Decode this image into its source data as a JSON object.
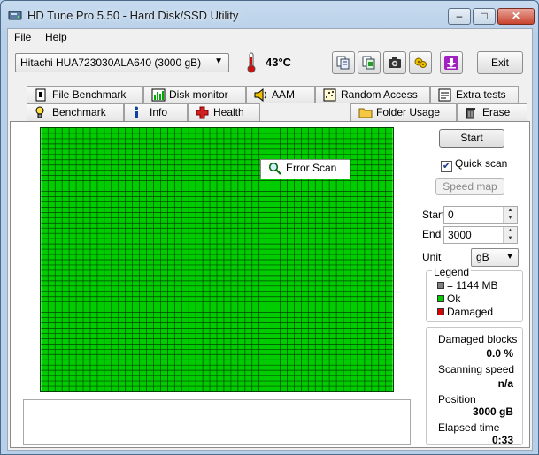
{
  "window": {
    "title": "HD Tune Pro 5.50 - Hard Disk/SSD Utility",
    "minimize": "–",
    "maximize": "□",
    "close": "✕"
  },
  "menu": {
    "file": "File",
    "help": "Help"
  },
  "toolbar": {
    "drive": "Hitachi HUA723030ALA640 (3000 gB)",
    "temperature": "43°C",
    "buttons": [
      "copy-info-icon",
      "copy-text-icon",
      "screenshot-icon",
      "options-icon",
      "save-icon"
    ],
    "exit_label": "Exit"
  },
  "tabs": {
    "row1": [
      "File Benchmark",
      "Disk monitor",
      "AAM",
      "Random Access",
      "Extra tests"
    ],
    "row2": [
      "Benchmark",
      "Info",
      "Health",
      "Error Scan",
      "Folder Usage",
      "Erase"
    ],
    "active": "Error Scan"
  },
  "scan": {
    "block_color_ok": "#00cc00",
    "grid_line_color": "#004400",
    "start_button": "Start",
    "quick_scan_label": "Quick scan",
    "quick_scan_checked": true,
    "speed_map_button": "Speed map",
    "start_label": "Start",
    "start_value": "0",
    "end_label": "End",
    "end_value": "3000",
    "unit_label": "Unit",
    "unit_value": "gB",
    "log_text": ""
  },
  "legend": {
    "title": "Legend",
    "items": [
      {
        "label": "= 1144 MB",
        "color": "#808080"
      },
      {
        "label": "Ok",
        "color": "#00cc00"
      },
      {
        "label": "Damaged",
        "color": "#dd0000"
      }
    ]
  },
  "stats": {
    "damaged_blocks_label": "Damaged blocks",
    "damaged_blocks_value": "0.0 %",
    "scanning_speed_label": "Scanning speed",
    "scanning_speed_value": "n/a",
    "position_label": "Position",
    "position_value": "3000 gB",
    "elapsed_label": "Elapsed time",
    "elapsed_value": "0:33"
  }
}
